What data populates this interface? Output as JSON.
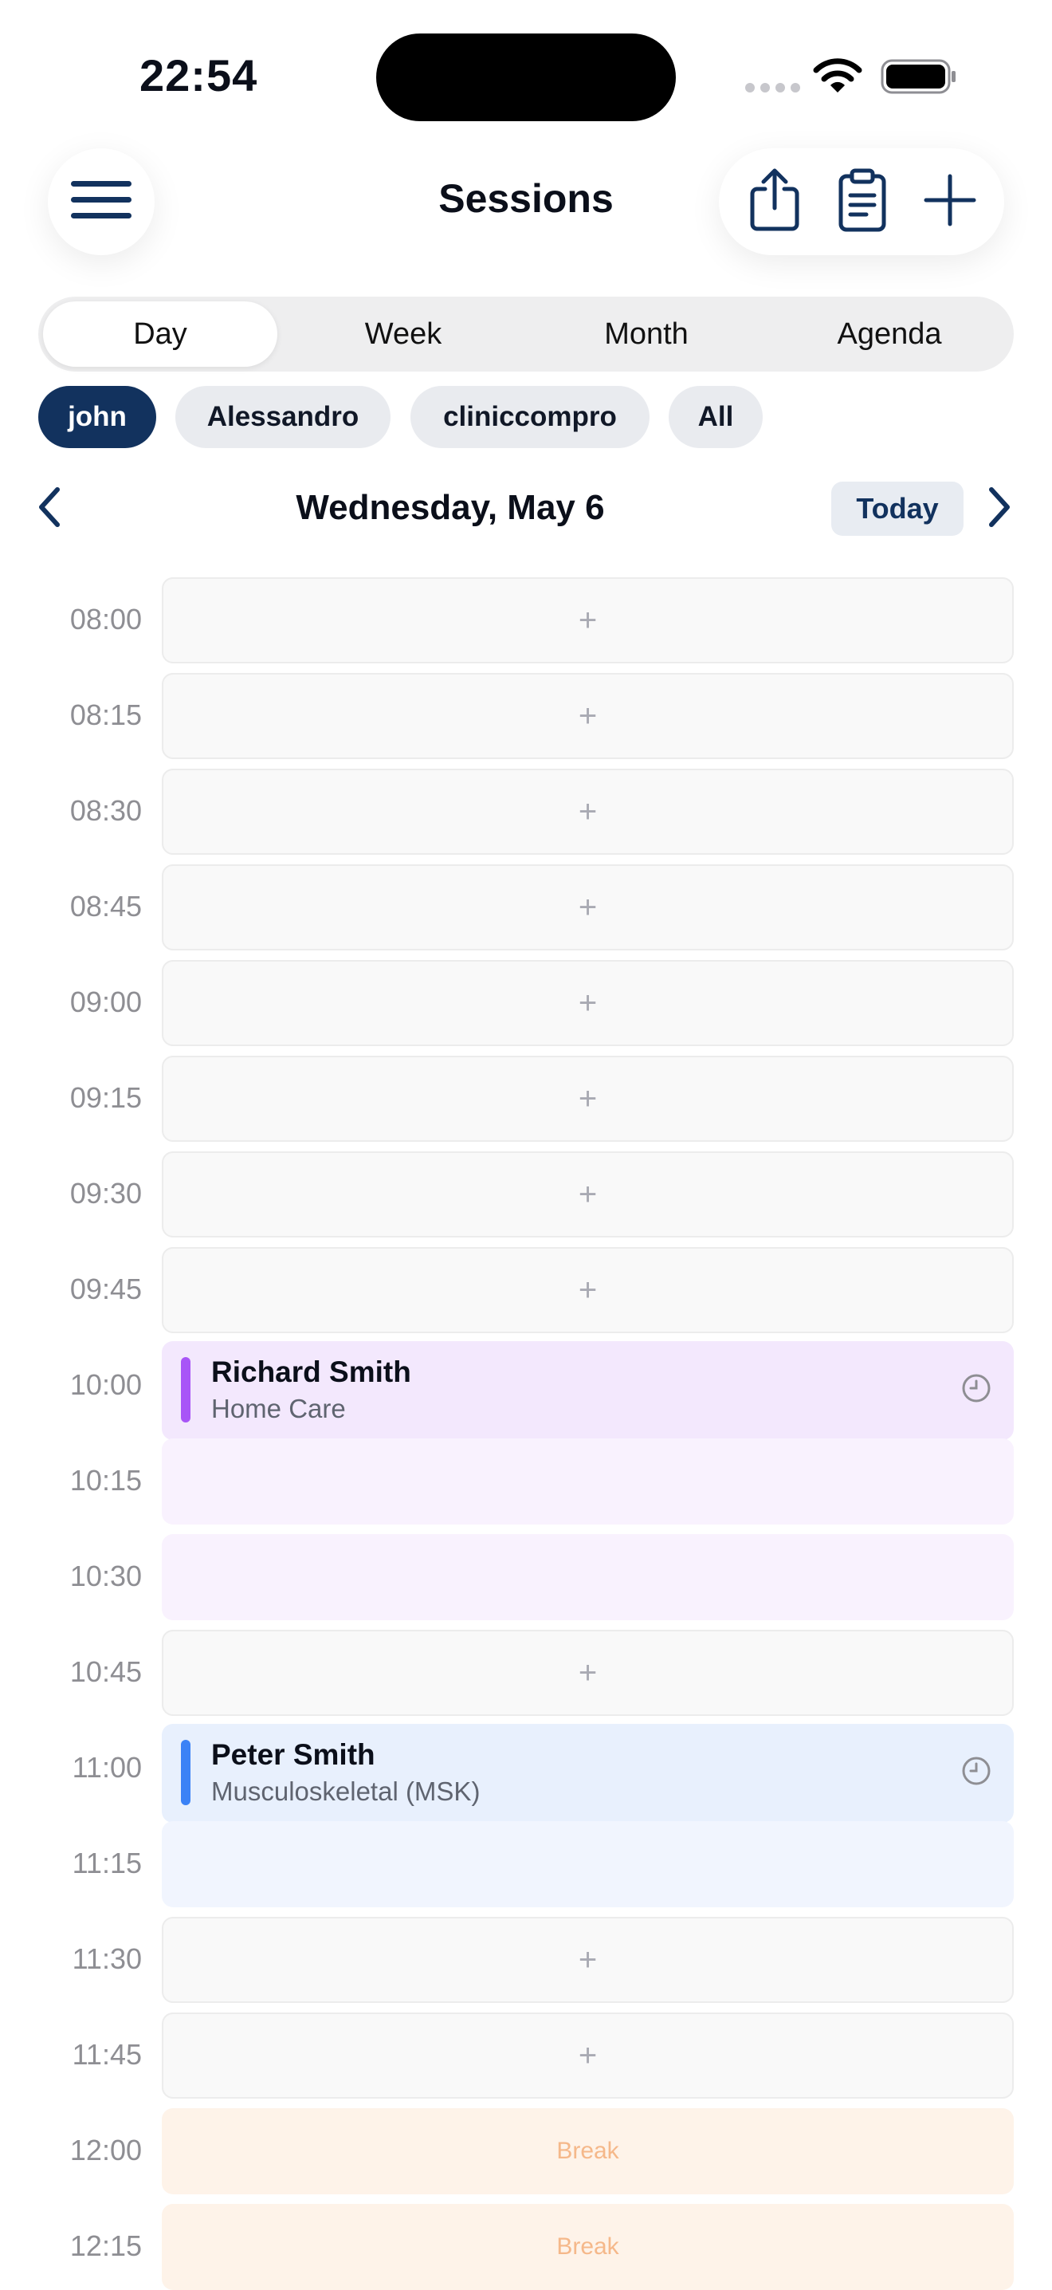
{
  "status": {
    "time": "22:54"
  },
  "header": {
    "title": "Sessions",
    "menu_icon": "hamburger-icon",
    "actions": [
      "share-icon",
      "clipboard-icon",
      "plus-icon"
    ]
  },
  "view_tabs": [
    {
      "label": "Day",
      "active": true
    },
    {
      "label": "Week",
      "active": false
    },
    {
      "label": "Month",
      "active": false
    },
    {
      "label": "Agenda",
      "active": false
    }
  ],
  "filters": [
    {
      "label": "john",
      "active": true
    },
    {
      "label": "Alessandro",
      "active": false
    },
    {
      "label": "cliniccompro",
      "active": false
    },
    {
      "label": "All",
      "active": false
    }
  ],
  "date_nav": {
    "label": "Wednesday, May 6",
    "today_label": "Today"
  },
  "slots": [
    {
      "time": "08:00",
      "kind": "empty"
    },
    {
      "time": "08:15",
      "kind": "empty"
    },
    {
      "time": "08:30",
      "kind": "empty"
    },
    {
      "time": "08:45",
      "kind": "empty"
    },
    {
      "time": "09:00",
      "kind": "empty"
    },
    {
      "time": "09:15",
      "kind": "empty"
    },
    {
      "time": "09:30",
      "kind": "empty"
    },
    {
      "time": "09:45",
      "kind": "empty"
    },
    {
      "time": "10:00",
      "kind": "event",
      "name": "Richard Smith",
      "type": "Home Care",
      "color": "#a855f7"
    },
    {
      "time": "10:15",
      "kind": "cont",
      "color": "purple"
    },
    {
      "time": "10:30",
      "kind": "cont",
      "color": "purple"
    },
    {
      "time": "10:45",
      "kind": "empty"
    },
    {
      "time": "11:00",
      "kind": "event",
      "name": "Peter Smith",
      "type": "Musculoskeletal (MSK)",
      "color": "#3b82f6"
    },
    {
      "time": "11:15",
      "kind": "cont",
      "color": "blue"
    },
    {
      "time": "11:30",
      "kind": "empty"
    },
    {
      "time": "11:45",
      "kind": "empty"
    },
    {
      "time": "12:00",
      "kind": "break",
      "label": "Break"
    },
    {
      "time": "12:15",
      "kind": "break",
      "label": "Break"
    }
  ],
  "empty_slot_symbol": "+"
}
